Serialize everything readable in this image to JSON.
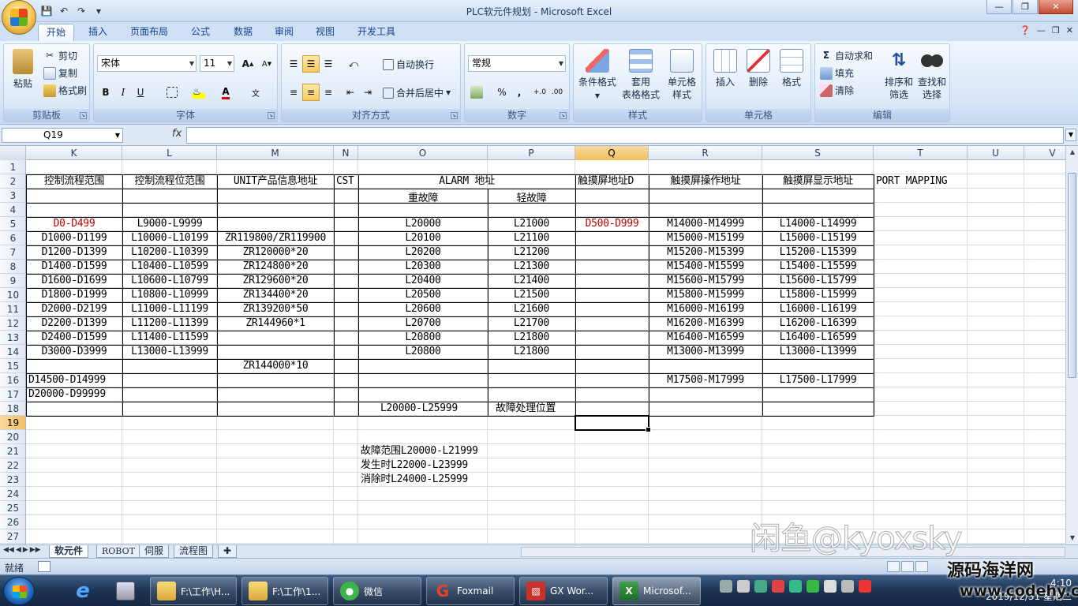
{
  "window": {
    "title": "PLC软元件规划 - Microsoft Excel"
  },
  "ribbon_tabs": [
    "开始",
    "插入",
    "页面布局",
    "公式",
    "数据",
    "审阅",
    "视图",
    "开发工具"
  ],
  "ribbon": {
    "clipboard": {
      "label": "剪贴板",
      "paste": "粘贴",
      "cut": "剪切",
      "copy": "复制",
      "format_painter": "格式刷"
    },
    "font": {
      "label": "字体",
      "font_name": "宋体",
      "font_size": "11",
      "grow": "A",
      "shrink": "A",
      "bold": "B",
      "italic": "I",
      "underline": "U"
    },
    "alignment": {
      "label": "对齐方式",
      "wrap": "自动换行",
      "merge": "合并后居中"
    },
    "number": {
      "label": "数字",
      "format": "常规",
      "percent": "%",
      "comma": ",",
      "inc_dec": "+.0",
      "dec_dec": ".00"
    },
    "styles": {
      "label": "样式",
      "conditional": "条件格式",
      "table_fmt_1": "套用",
      "table_fmt_2": "表格格式",
      "cell_style_1": "单元格",
      "cell_style_2": "样式"
    },
    "cells": {
      "label": "单元格",
      "insert": "插入",
      "delete": "删除",
      "format": "格式"
    },
    "editing": {
      "label": "编辑",
      "autosum": "自动求和",
      "fill": "填充",
      "clear": "清除",
      "sort_1": "排序和",
      "sort_2": "筛选",
      "find_1": "查找和",
      "find_2": "选择"
    }
  },
  "formula_bar": {
    "name_box": "Q19",
    "fx": "fx",
    "value": ""
  },
  "columns": [
    "K",
    "L",
    "M",
    "N",
    "O",
    "P",
    "Q",
    "R",
    "S",
    "T",
    "U",
    "V"
  ],
  "selected_column": "Q",
  "rows": [
    "1",
    "2",
    "3",
    "4",
    "5",
    "6",
    "7",
    "8",
    "9",
    "10",
    "11",
    "12",
    "13",
    "14",
    "15",
    "16",
    "17",
    "18",
    "19",
    "20",
    "21",
    "22",
    "23",
    "24",
    "25",
    "26",
    "27"
  ],
  "selected_row": "19",
  "cells": {
    "K2": "控制流程范围",
    "L2": "控制流程位范围",
    "M2": "UNIT产品信息地址",
    "N2": "CST",
    "O2": "ALARM 地址",
    "Q2": "触摸屏地址D",
    "R2": "触摸屏操作地址",
    "S2": "触摸屏显示地址",
    "T2": "PORT MAPPING",
    "O3": "重故障",
    "P3": "轻故障",
    "K5": "D0-D499",
    "L5": "L9000-L9999",
    "O5": "L20000",
    "P5": "L21000",
    "Q5": "D500-D999",
    "R5": "M14000-M14999",
    "S5": "L14000-L14999",
    "K6": "D1000-D1199",
    "L6": "L10000-L10199",
    "M6": "ZR119800/ZR119900",
    "O6": "L20100",
    "P6": "L21100",
    "R6": "M15000-M15199",
    "S6": "L15000-L15199",
    "K7": "D1200-D1399",
    "L7": "L10200-L10399",
    "M7": "ZR120000*20",
    "O7": "L20200",
    "P7": "L21200",
    "R7": "M15200-M15399",
    "S7": "L15200-L15399",
    "K8": "D1400-D1599",
    "L8": "L10400-L10599",
    "M8": "ZR124800*20",
    "O8": "L20300",
    "P8": "L21300",
    "R8": "M15400-M15599",
    "S8": "L15400-L15599",
    "K9": "D1600-D1699",
    "L9": "L10600-L10799",
    "M9": "ZR129600*20",
    "O9": "L20400",
    "P9": "L21400",
    "R9": "M15600-M15799",
    "S9": "L15600-L15799",
    "K10": "D1800-D1999",
    "L10": "L10800-L10999",
    "M10": "ZR134400*20",
    "O10": "L20500",
    "P10": "L21500",
    "R10": "M15800-M15999",
    "S10": "L15800-L15999",
    "K11": "D2000-D2199",
    "L11": "L11000-L11199",
    "M11": "ZR139200*50",
    "O11": "L20600",
    "P11": "L21600",
    "R11": "M16000-M16199",
    "S11": "L16000-L16199",
    "K12": "D2200-D1399",
    "L12": "L11200-L11399",
    "M12": "ZR144960*1",
    "O12": "L20700",
    "P12": "L21700",
    "R12": "M16200-M16399",
    "S12": "L16200-L16399",
    "K13": "D2400-D1599",
    "L13": "L11400-L11599",
    "O13": "L20800",
    "P13": "L21800",
    "R13": "M16400-M16599",
    "S13": "L16400-L16599",
    "K14": "D3000-D3999",
    "L14": "L13000-L13999",
    "O14": "L20800",
    "P14": "L21800",
    "R14": "M13000-M13999",
    "S14": "L13000-L13999",
    "M15": "ZR144000*10",
    "K16": "D14500-D14999",
    "R16": "M17500-M17999",
    "S16": "L17500-L17999",
    "K17": "D20000-D99999",
    "O18": "L20000-L25999",
    "P18": "故障处理位置",
    "O21": "故障范围L20000-L21999",
    "O22": "发生时L22000-L23999",
    "O23": "消除时L24000-L25999"
  },
  "sheets": [
    "软元件",
    "ROBOT",
    "伺服",
    "流程图"
  ],
  "active_sheet": "软元件",
  "status": {
    "ready": "就绪",
    "zoom": "100%"
  },
  "taskbar": {
    "tasks": [
      "F:\\工作\\H...",
      "F:\\工作\\1...",
      "微信",
      "Foxmail",
      "GX Wor...",
      "Microsof..."
    ],
    "time": "4:10",
    "date": "2019/12/31 星期二"
  },
  "watermark": {
    "text1": "闲鱼@kyoxsky",
    "text2": "源码海洋网",
    "text3": "www.codehy.com"
  },
  "colors": {
    "accent": "#15428b",
    "red_text": "#c00000",
    "selection": "#f1c05e"
  }
}
